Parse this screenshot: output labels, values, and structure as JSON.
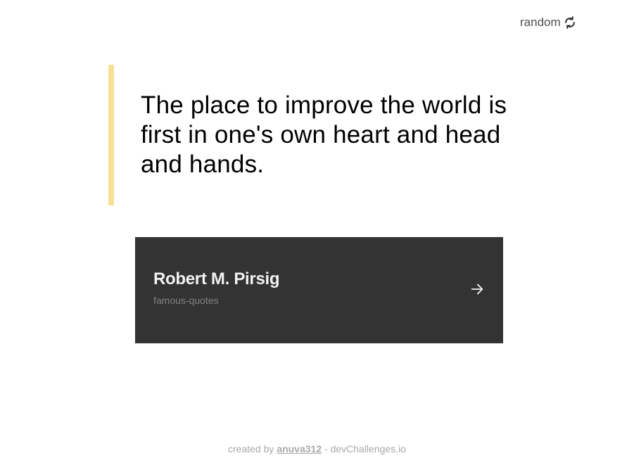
{
  "header": {
    "random_label": "random",
    "random_icon": "refresh-icon"
  },
  "quote": {
    "text": "The place to improve the world is first in one's own heart and head and hands.",
    "accent_color": "#f7df94"
  },
  "author_card": {
    "name": "Robert M. Pirsig",
    "genre": "famous-quotes",
    "arrow_icon": "arrow-right-icon",
    "background": "#333333"
  },
  "footer": {
    "prefix": "created by",
    "author_link": "anuva312",
    "separator": "-",
    "site": "devChallenges.io"
  }
}
